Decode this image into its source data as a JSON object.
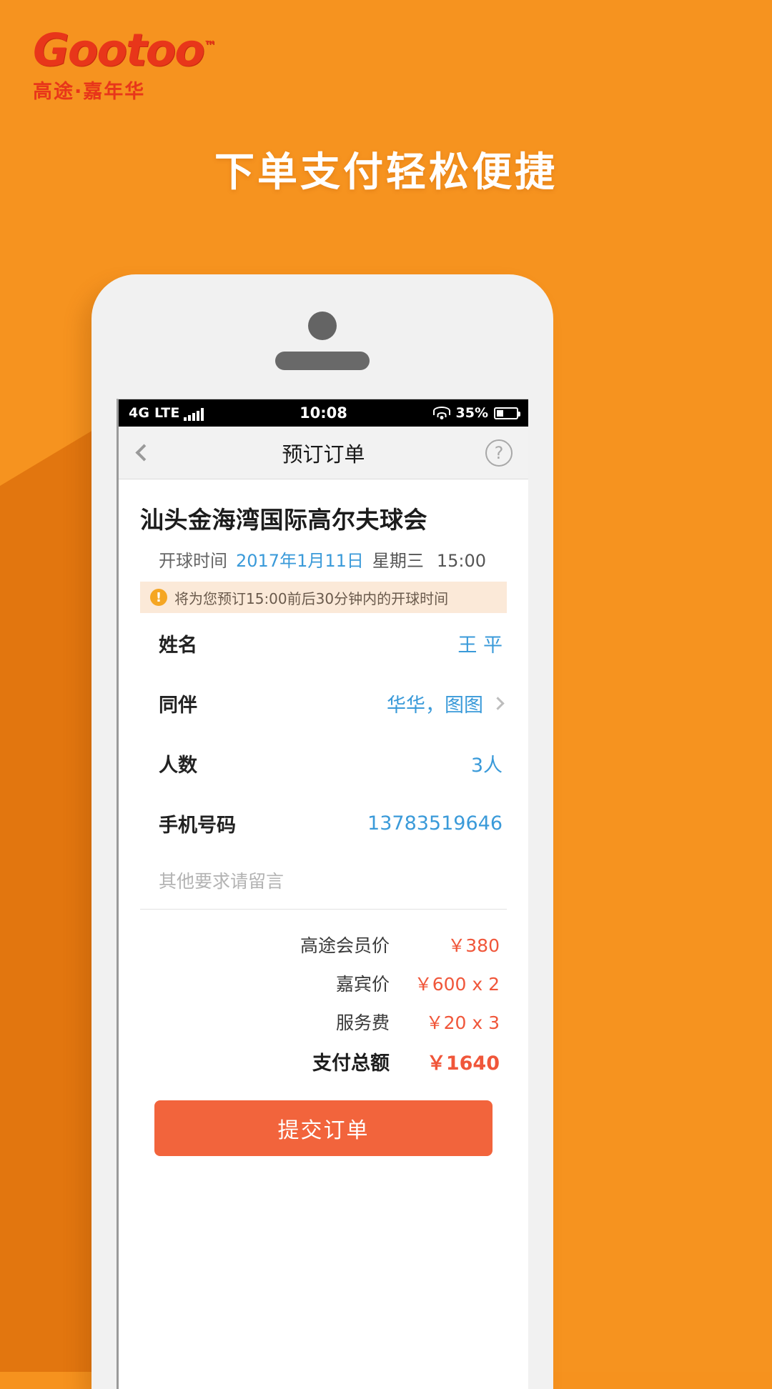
{
  "brand": {
    "logo_word": "Gootoo",
    "logo_tm": "™",
    "logo_sub": "高途·嘉年华"
  },
  "headline": "下单支付轻松便捷",
  "phone": {
    "status_bar": {
      "carrier": "4G LTE",
      "time": "10:08",
      "battery_percent": "35%",
      "wifi_icon": "wifi-icon",
      "signal_icon": "signal-bars-icon",
      "battery_icon": "battery-icon"
    },
    "nav": {
      "back_icon": "chevron-left-icon",
      "title": "预订订单",
      "help_icon": "question-mark-icon",
      "help_label": "?"
    },
    "order": {
      "course_name": "汕头金海湾国际高尔夫球会",
      "tee_label": "开球时间",
      "tee_date": "2017年1月11日",
      "tee_weekday": "星期三",
      "tee_time": "15:00",
      "notice_icon": "warning-icon",
      "notice_icon_glyph": "!",
      "notice_text": "将为您预订15:00前后30分钟内的开球时间",
      "fields": [
        {
          "label": "姓名",
          "value": "王 平",
          "has_arrow": false
        },
        {
          "label": "同伴",
          "value": "华华，图图",
          "has_arrow": true
        },
        {
          "label": "人数",
          "value": "3人",
          "has_arrow": false
        },
        {
          "label": "手机号码",
          "value": "13783519646",
          "has_arrow": false
        }
      ],
      "memo_placeholder": "其他要求请留言",
      "prices": [
        {
          "label": "高途会员价",
          "value": "￥380"
        },
        {
          "label": "嘉宾价",
          "value": "￥600 x 2"
        },
        {
          "label": "服务费",
          "value": "￥20 x 3"
        }
      ],
      "total": {
        "label": "支付总额",
        "value": "￥1640"
      },
      "submit_label": "提交订单"
    }
  },
  "colors": {
    "background": "#f6931f",
    "background_shade": "#e2760f",
    "brand_red": "#e8361a",
    "accent_blue": "#3a9ad9",
    "price_orange": "#f0563a",
    "button": "#f2643c",
    "notice_bg": "#fbe9d8"
  }
}
